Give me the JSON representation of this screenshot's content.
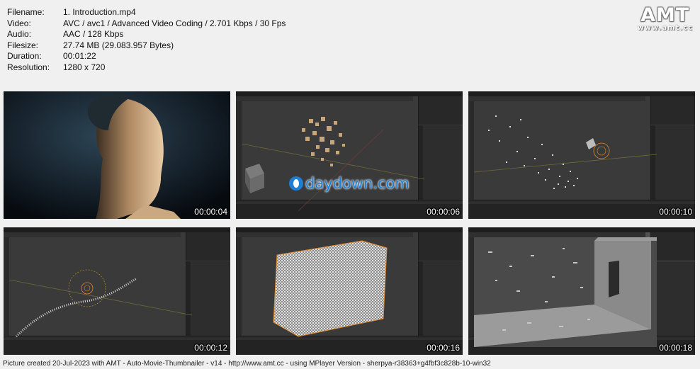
{
  "info": [
    {
      "label": "Filename:",
      "value": "1. Introduction.mp4"
    },
    {
      "label": "Video:",
      "value": "AVC / avc1 / Advanced Video Coding / 2.701 Kbps / 30 Fps"
    },
    {
      "label": "Audio:",
      "value": "AAC / 128 Kbps"
    },
    {
      "label": "Filesize:",
      "value": "27.74 MB (29.083.957 Bytes)"
    },
    {
      "label": "Duration:",
      "value": "00:01:22"
    },
    {
      "label": "Resolution:",
      "value": "1280 x 720"
    }
  ],
  "logo": {
    "title": "AMT",
    "url": "www.amt.cc"
  },
  "watermark": "daydown.com",
  "thumbs": [
    {
      "time": "00:00:04"
    },
    {
      "time": "00:00:06"
    },
    {
      "time": "00:00:10"
    },
    {
      "time": "00:00:12"
    },
    {
      "time": "00:00:16"
    },
    {
      "time": "00:00:18"
    }
  ],
  "footer": "Picture created 20-Jul-2023 with AMT - Auto-Movie-Thumbnailer - v14 - http://www.amt.cc - using MPlayer Version - sherpya-r38363+g4fbf3c828b-10-win32",
  "colors": {
    "background": "#f0f0f0",
    "blender_bg": "#3a3a3a",
    "watermark_blue": "#1e7fd6",
    "selection_orange": "#e08a2c"
  }
}
